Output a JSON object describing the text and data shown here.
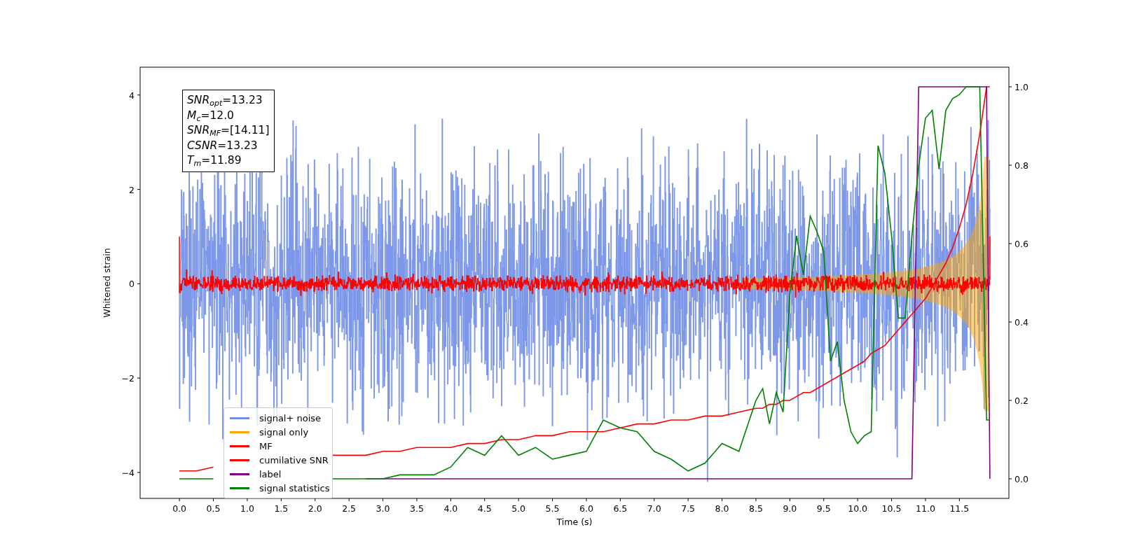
{
  "figure": {
    "annotation": [
      "*SNR*$_{opt}$=13.23",
      "*M*$_{c}$=12.0",
      "*SNR*$_{MF}$=[14.11]",
      "*CSNR*=13.23",
      "*T*$_{m}$=11.89"
    ],
    "plot": {
      "picture_traces": [
        {
          "kind": "noise",
          "name": "signal+ noise",
          "color": "#6f8de6"
        },
        {
          "kind": "envelope",
          "name": "signal only",
          "color": "#ffa500"
        },
        {
          "kind": "filter",
          "name": "MF",
          "color": "#ff0000"
        }
      ],
      "chart_data": {
        "type": "line",
        "xlabel": "Time (s)",
        "ylabel": "Whitened strain",
        "xlim": [
          -0.58,
          12.23
        ],
        "ylim": [
          -4.55,
          4.59
        ],
        "y2lim": [
          -0.05,
          1.05
        ],
        "xticks": [
          {
            "value": 0,
            "label": "0.0"
          },
          {
            "value": 0.5,
            "label": "0.5"
          },
          {
            "value": 1,
            "label": "1.0"
          },
          {
            "value": 1.5,
            "label": "1.5"
          },
          {
            "value": 2,
            "label": "2.0"
          },
          {
            "value": 2.5,
            "label": "2.5"
          },
          {
            "value": 3,
            "label": "3.0"
          },
          {
            "value": 3.5,
            "label": "3.5"
          },
          {
            "value": 4,
            "label": "4.0"
          },
          {
            "value": 4.5,
            "label": "4.5"
          },
          {
            "value": 5,
            "label": "5.0"
          },
          {
            "value": 5.5,
            "label": "5.5"
          },
          {
            "value": 6,
            "label": "6.0"
          },
          {
            "value": 6.5,
            "label": "6.5"
          },
          {
            "value": 7,
            "label": "7.0"
          },
          {
            "value": 7.5,
            "label": "7.5"
          },
          {
            "value": 8,
            "label": "8.0"
          },
          {
            "value": 8.5,
            "label": "8.5"
          },
          {
            "value": 9,
            "label": "9.0"
          },
          {
            "value": 9.5,
            "label": "9.5"
          },
          {
            "value": 10,
            "label": "10.0"
          },
          {
            "value": 10.5,
            "label": "10.5"
          },
          {
            "value": 11,
            "label": "11.0"
          },
          {
            "value": 11.5,
            "label": "11.5"
          }
        ],
        "yticks": [
          {
            "value": 4,
            "label": "4"
          },
          {
            "value": 2,
            "label": "2"
          },
          {
            "value": 0,
            "label": "0"
          },
          {
            "value": -2,
            "label": "−2"
          },
          {
            "value": -4,
            "label": "−4"
          }
        ],
        "y2ticks": [
          {
            "value": 1,
            "label": "1.0"
          },
          {
            "value": 0.8,
            "label": "0.8"
          },
          {
            "value": 0.6,
            "label": "0.6"
          },
          {
            "value": 0.4,
            "label": "0.4"
          },
          {
            "value": 0.2,
            "label": "0.2"
          },
          {
            "value": 0,
            "label": "0.0"
          }
        ],
        "x": [
          0,
          0.25,
          0.5,
          0.75,
          1,
          1.25,
          1.5,
          1.75,
          2,
          2.25,
          2.5,
          2.75,
          3,
          3.25,
          3.5,
          3.75,
          4,
          4.25,
          4.5,
          4.75,
          5,
          5.25,
          5.5,
          5.75,
          6,
          6.25,
          6.5,
          6.75,
          7,
          7.25,
          7.5,
          7.75,
          8,
          8.25,
          8.5,
          8.6,
          8.7,
          8.8,
          8.9,
          9,
          9.1,
          9.2,
          9.3,
          9.4,
          9.5,
          9.6,
          9.7,
          9.8,
          9.9,
          10,
          10.1,
          10.2,
          10.3,
          10.4,
          10.5,
          10.6,
          10.7,
          10.8,
          10.9,
          11,
          11.1,
          11.2,
          11.3,
          11.4,
          11.5,
          11.6,
          11.7,
          11.8,
          11.9,
          11.95
        ],
        "series": [
          {
            "name": "cumilative SNR",
            "color": "#ff0000",
            "axis": "y2",
            "values": [
              0.02,
              0.02,
              0.03,
              null,
              null,
              null,
              null,
              null,
              null,
              0.06,
              0.06,
              0.06,
              0.07,
              0.07,
              0.08,
              0.08,
              0.08,
              0.09,
              0.09,
              0.1,
              0.1,
              0.11,
              0.11,
              0.12,
              0.12,
              0.12,
              0.13,
              0.14,
              0.14,
              0.15,
              0.15,
              0.16,
              0.16,
              0.17,
              0.18,
              0.18,
              0.19,
              0.19,
              0.2,
              0.2,
              0.21,
              0.22,
              0.22,
              0.23,
              0.24,
              0.25,
              0.26,
              0.27,
              0.28,
              0.29,
              0.3,
              0.32,
              0.33,
              0.34,
              0.36,
              0.38,
              0.4,
              0.42,
              0.44,
              0.46,
              0.49,
              0.52,
              0.55,
              0.59,
              0.64,
              0.7,
              0.78,
              0.88,
              1.0,
              1.0
            ]
          },
          {
            "name": "label",
            "color": "#800080",
            "axis": "y2",
            "values": [
              null,
              null,
              null,
              null,
              null,
              null,
              null,
              null,
              null,
              null,
              null,
              0,
              0,
              0,
              0,
              0,
              0,
              0,
              0,
              0,
              0,
              0,
              0,
              0,
              0,
              0,
              0,
              0,
              0,
              0,
              0,
              0,
              0,
              0,
              0,
              0,
              0,
              0,
              0,
              0,
              0,
              0,
              0,
              0,
              0,
              0,
              0,
              0,
              0,
              0,
              0,
              0,
              0,
              0,
              0,
              0,
              0,
              0,
              1,
              1,
              1,
              1,
              1,
              1,
              1,
              1,
              1,
              1,
              1,
              0
            ]
          },
          {
            "name": "signal statistics",
            "color": "#008000",
            "axis": "y2",
            "values": [
              0,
              0,
              0,
              null,
              null,
              null,
              null,
              null,
              null,
              0,
              0,
              0,
              0,
              0.01,
              0.01,
              0.01,
              0.03,
              0.08,
              0.06,
              0.11,
              0.06,
              0.08,
              0.05,
              0.06,
              0.07,
              0.15,
              0.13,
              0.12,
              0.07,
              0.05,
              0.02,
              0.04,
              0.09,
              0.07,
              0.2,
              0.23,
              0.14,
              0.22,
              0.17,
              0.47,
              0.62,
              0.52,
              0.67,
              0.63,
              0.58,
              0.3,
              0.35,
              0.2,
              0.12,
              0.09,
              0.11,
              0.12,
              0.85,
              0.78,
              0.62,
              0.41,
              0.41,
              0.62,
              0.8,
              0.92,
              0.94,
              0.79,
              0.94,
              0.97,
              0.98,
              1.0,
              1.0,
              1.0,
              0.15,
              0.15
            ]
          }
        ]
      }
    }
  }
}
